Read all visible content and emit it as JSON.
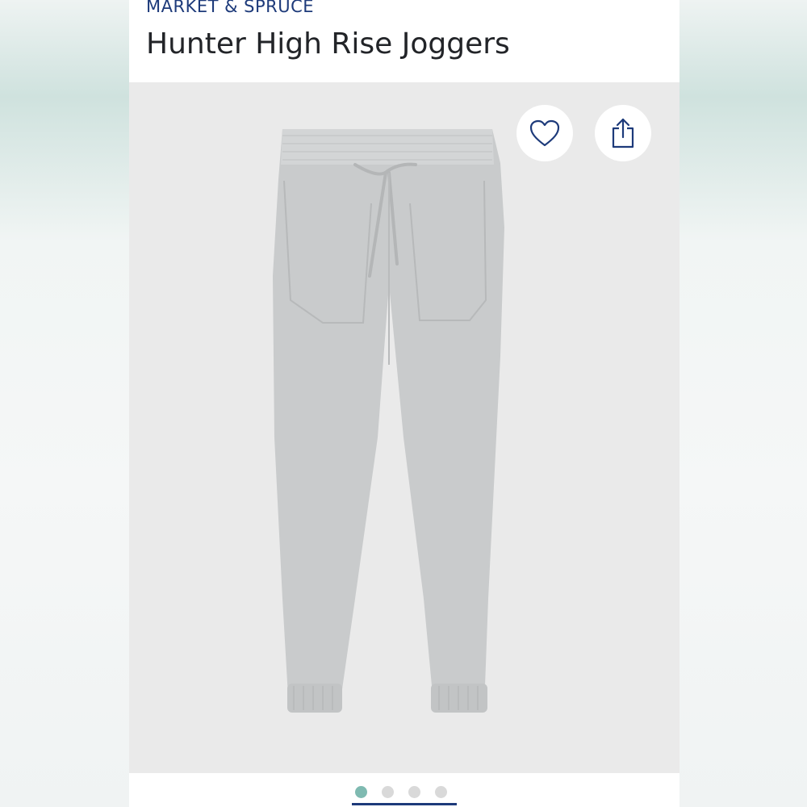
{
  "header": {
    "brand": "MARKET & SPRUCE",
    "title": "Hunter High Rise Joggers"
  },
  "actions": {
    "favorite_icon": "heart-icon",
    "share_icon": "share-icon"
  },
  "gallery": {
    "image": "gray joggers product photo",
    "total_images": 4,
    "active_index": 1
  },
  "colors": {
    "brand": "#1d3a7a",
    "active_dot": "#7fbab1",
    "inactive_dot": "#d9d9d9",
    "garment": "#c9cbcc"
  }
}
